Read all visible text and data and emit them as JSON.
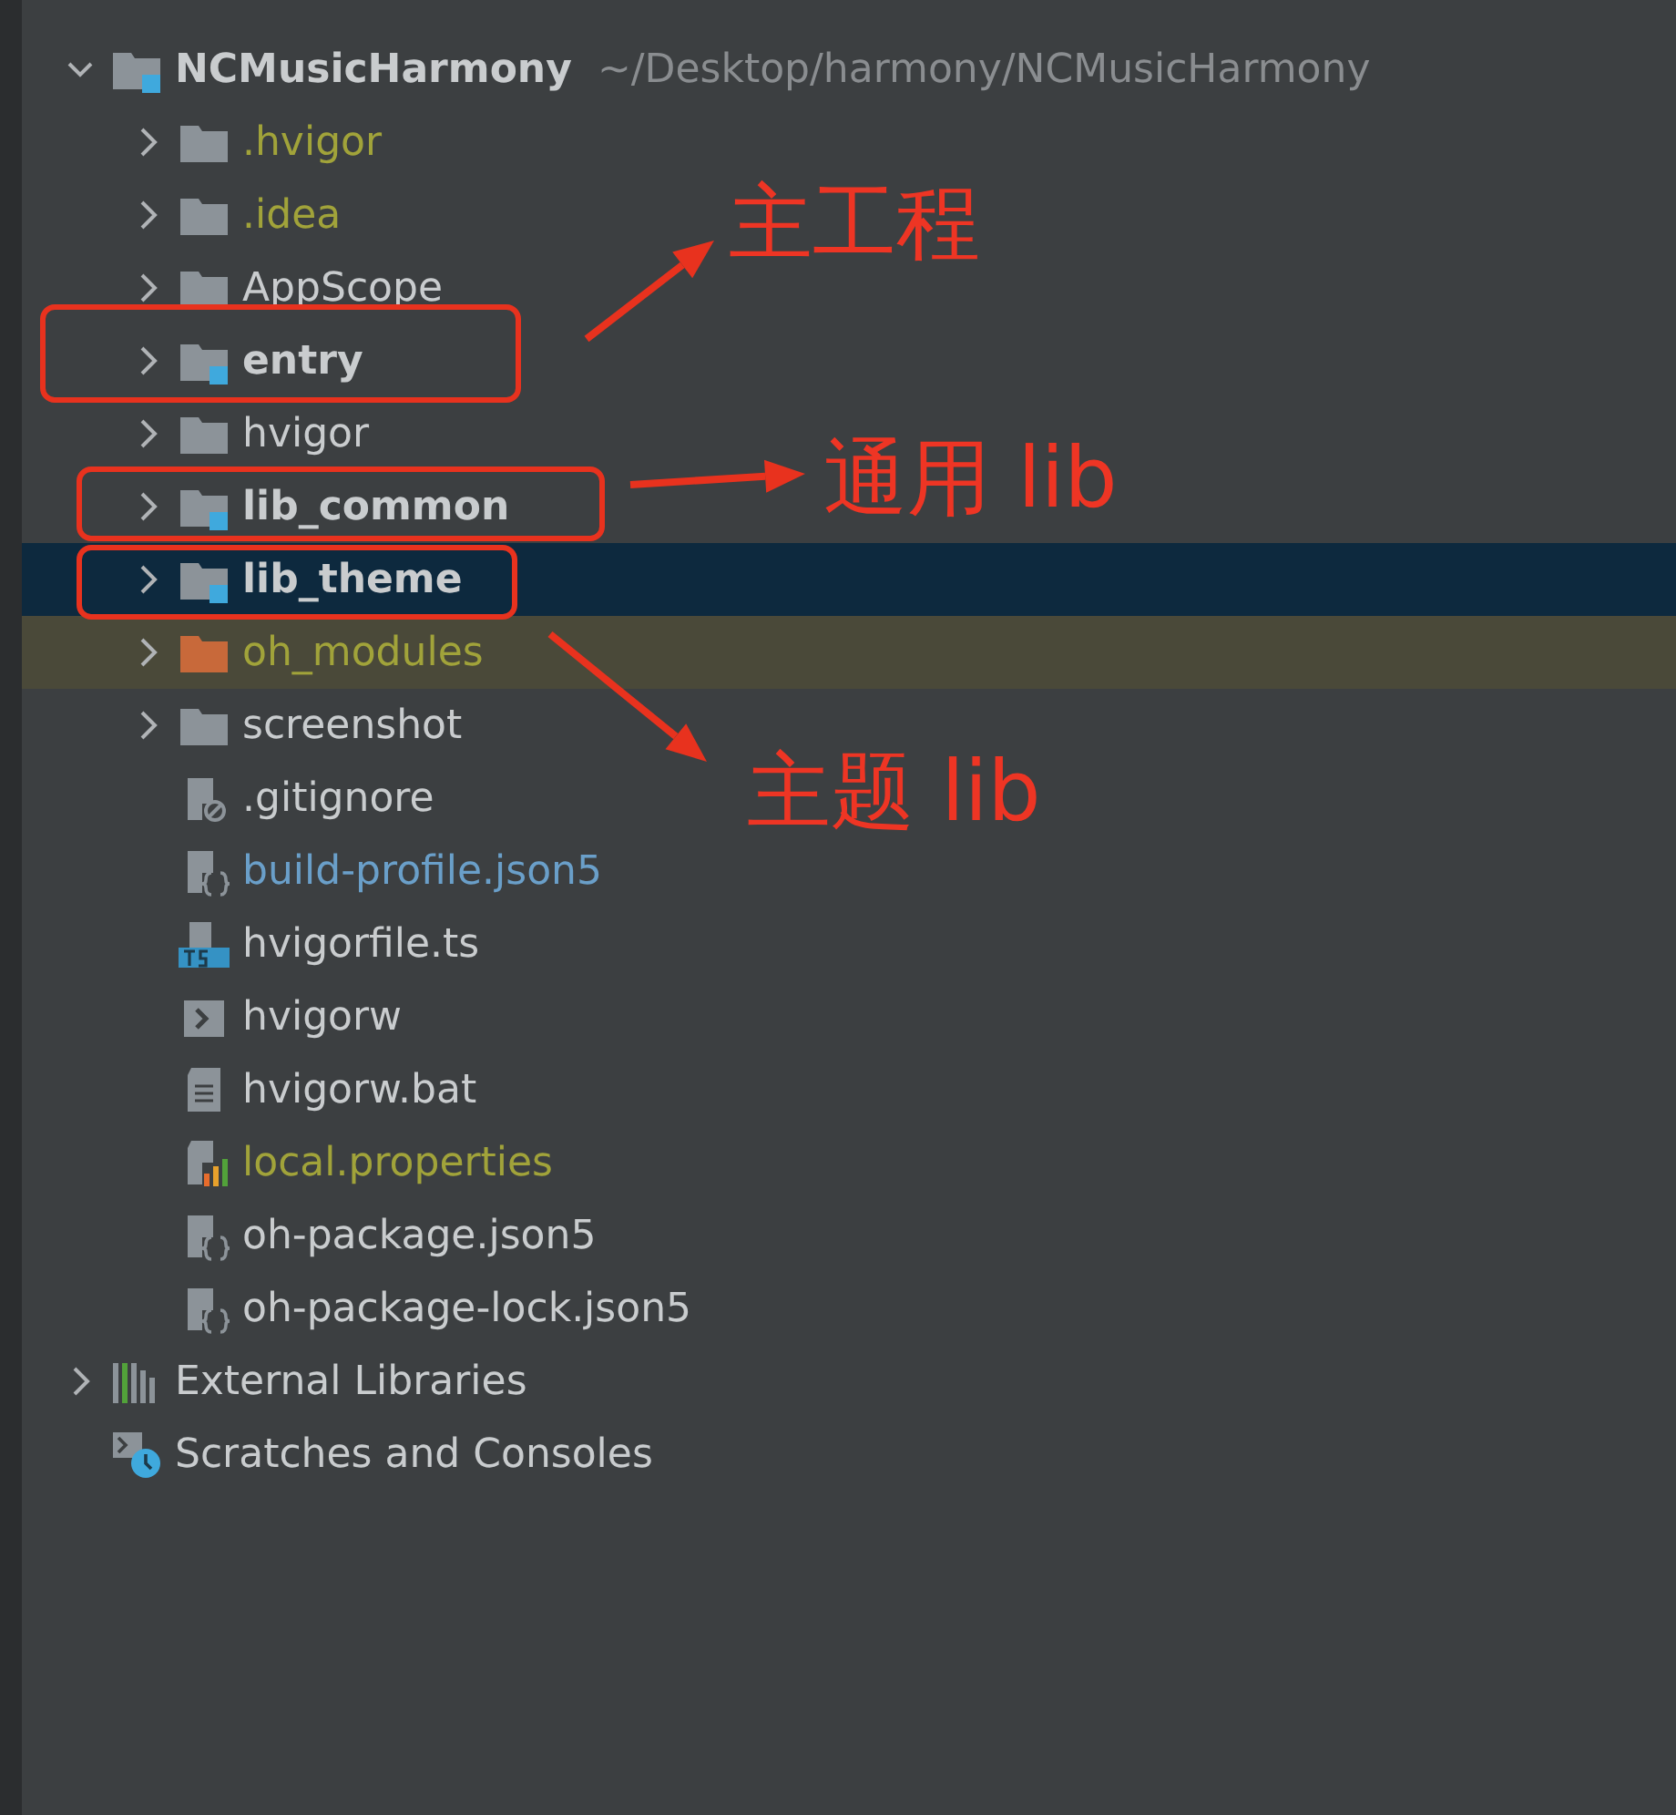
{
  "project_tree": [
    {
      "name": "NCMusicHarmony",
      "path": "~/Desktop/harmony/NCMusicHarmony",
      "kind": "module",
      "expanded": true,
      "selected": false,
      "excluded": false,
      "color": "#c9ccce",
      "children": [
        {
          "name": ".hvigor",
          "kind": "folder",
          "expanded": false,
          "selected": false,
          "excluded": false,
          "color": "#a1a33a"
        },
        {
          "name": ".idea",
          "kind": "folder",
          "expanded": false,
          "selected": false,
          "excluded": false,
          "color": "#a1a33a"
        },
        {
          "name": "AppScope",
          "kind": "folder",
          "expanded": false,
          "selected": false,
          "excluded": false,
          "color": "#c9ccce"
        },
        {
          "name": "entry",
          "kind": "module",
          "expanded": false,
          "selected": false,
          "excluded": false,
          "color": "#c9ccce"
        },
        {
          "name": "hvigor",
          "kind": "folder",
          "expanded": false,
          "selected": false,
          "excluded": false,
          "color": "#c9ccce"
        },
        {
          "name": "lib_common",
          "kind": "module",
          "expanded": false,
          "selected": false,
          "excluded": false,
          "color": "#c9ccce"
        },
        {
          "name": "lib_theme",
          "kind": "module",
          "expanded": false,
          "selected": true,
          "excluded": false,
          "color": "#c9ccce"
        },
        {
          "name": "oh_modules",
          "kind": "excluded-folder",
          "expanded": false,
          "selected": false,
          "excluded": true,
          "color": "#a1a33a"
        },
        {
          "name": "screenshot",
          "kind": "folder",
          "expanded": false,
          "selected": false,
          "excluded": false,
          "color": "#c9ccce"
        },
        {
          "name": ".gitignore",
          "kind": "ignore-file",
          "selected": false,
          "excluded": false,
          "color": "#c9ccce"
        },
        {
          "name": "build-profile.json5",
          "kind": "json-file",
          "selected": false,
          "excluded": false,
          "color": "#6a9fc9"
        },
        {
          "name": "hvigorfile.ts",
          "kind": "ts-file",
          "selected": false,
          "excluded": false,
          "color": "#c9ccce"
        },
        {
          "name": "hvigorw",
          "kind": "script-file",
          "selected": false,
          "excluded": false,
          "color": "#c9ccce"
        },
        {
          "name": "hvigorw.bat",
          "kind": "text-file",
          "selected": false,
          "excluded": false,
          "color": "#c9ccce"
        },
        {
          "name": "local.properties",
          "kind": "properties-file",
          "selected": false,
          "excluded": false,
          "color": "#a1a33a"
        },
        {
          "name": "oh-package.json5",
          "kind": "json-file",
          "selected": false,
          "excluded": false,
          "color": "#c9ccce"
        },
        {
          "name": "oh-package-lock.json5",
          "kind": "json-file",
          "selected": false,
          "excluded": false,
          "color": "#c9ccce"
        }
      ]
    },
    {
      "name": "External Libraries",
      "kind": "libraries",
      "expanded": false,
      "selected": false,
      "excluded": false,
      "color": "#c9ccce"
    },
    {
      "name": "Scratches and Consoles",
      "kind": "scratches",
      "selected": false,
      "excluded": false,
      "color": "#c9ccce"
    }
  ],
  "annotations": [
    {
      "label": "主工程"
    },
    {
      "label": "通用 lib"
    },
    {
      "label": "主题 lib"
    }
  ]
}
